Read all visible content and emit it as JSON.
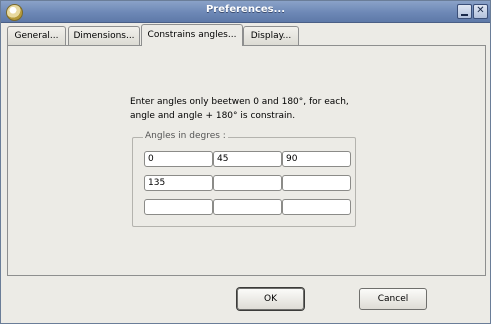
{
  "window": {
    "title": "Preferences..."
  },
  "tabs": [
    {
      "label": "General..."
    },
    {
      "label": "Dimensions..."
    },
    {
      "label": "Constrains angles..."
    },
    {
      "label": "Display..."
    }
  ],
  "instructions": {
    "line1": "Enter angles only beetwen 0 and 180°, for each,",
    "line2": "angle and angle + 180° is constrain."
  },
  "angles": {
    "legend": "Angles in degres :",
    "rows": [
      [
        "0",
        "45",
        "90"
      ],
      [
        "135",
        "",
        ""
      ],
      [
        "",
        "",
        ""
      ]
    ]
  },
  "buttons": {
    "ok": "OK",
    "cancel": "Cancel"
  }
}
